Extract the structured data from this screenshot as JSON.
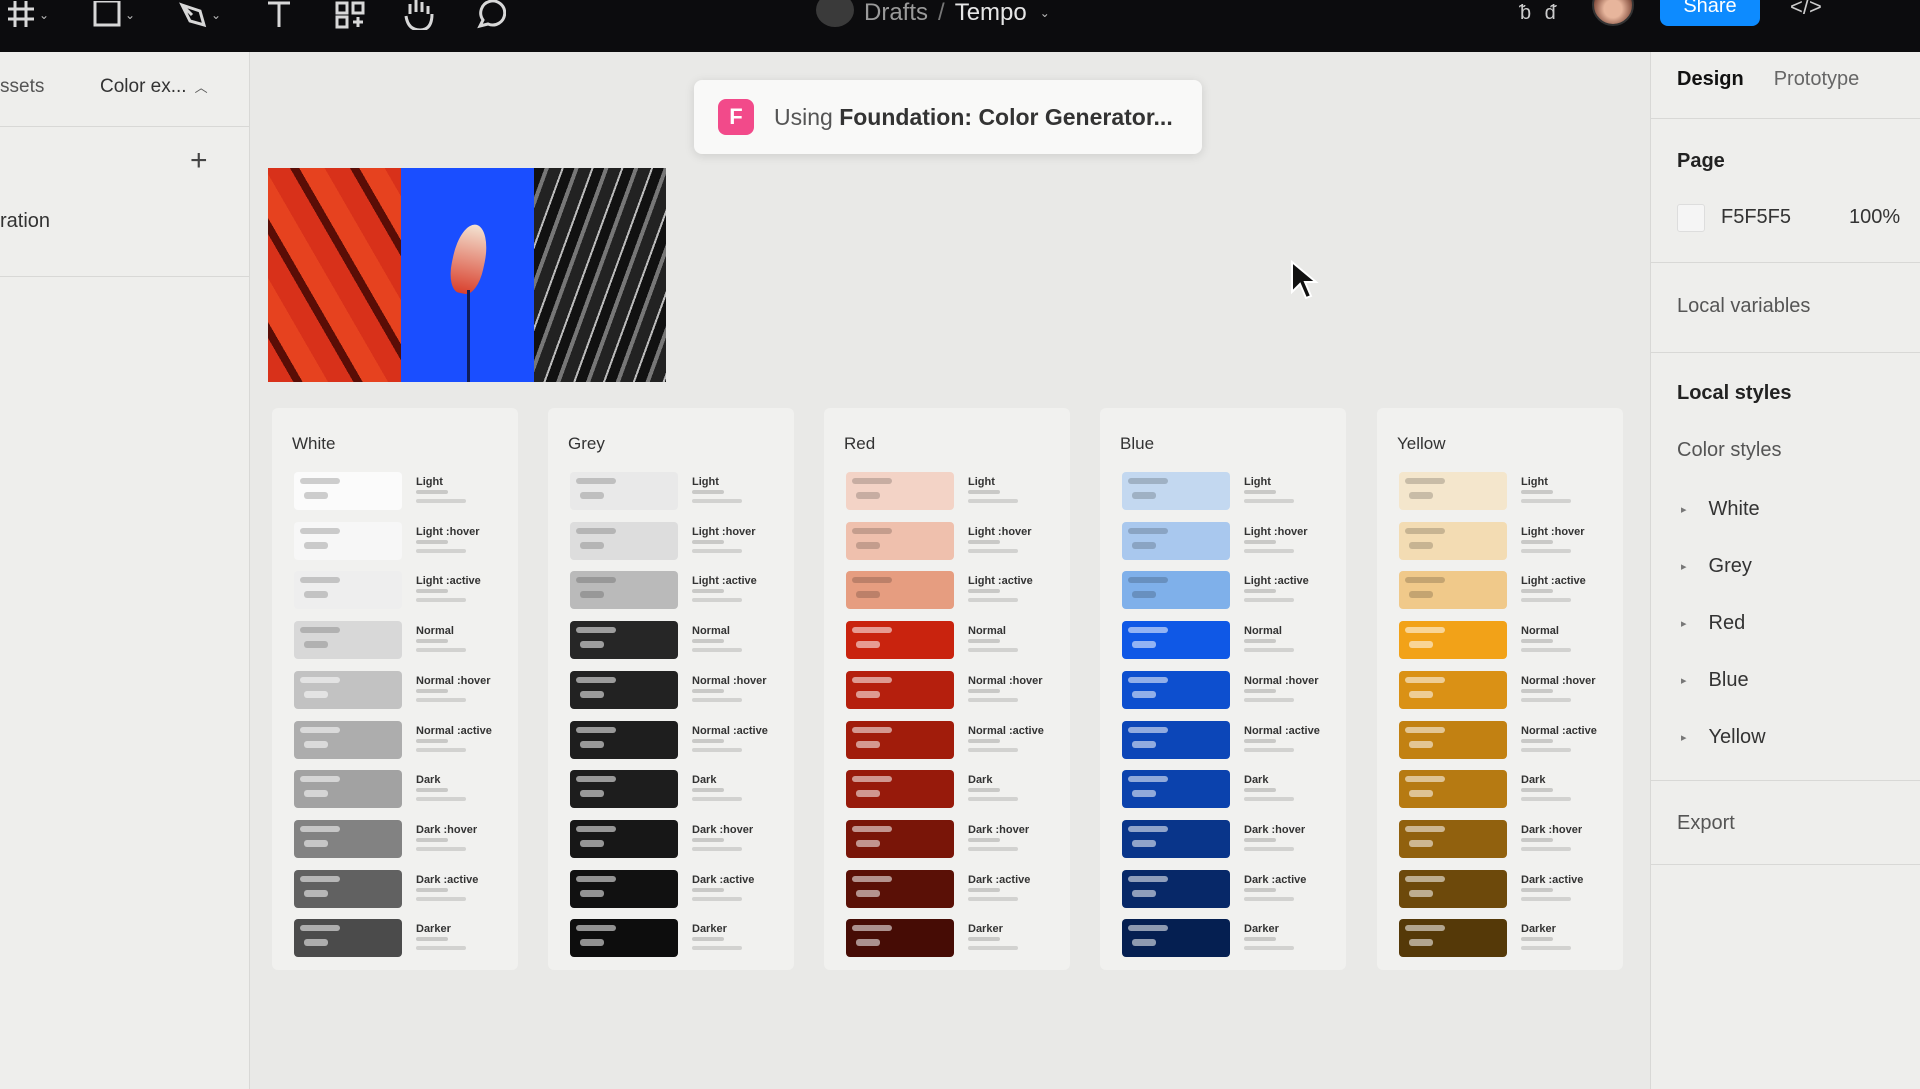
{
  "toolbar": {
    "file_project": "Drafts",
    "file_separator": "/",
    "file_name": "Tempo",
    "share_label": "Share",
    "multiplayer_glyph": "ᵬ ᵭ",
    "devmode_glyph": "</>",
    "icons": [
      "frame-icon",
      "shape-icon",
      "pen-icon",
      "text-icon",
      "component-icon",
      "hand-icon",
      "comment-icon"
    ]
  },
  "left_panel": {
    "assets_tab": "ssets",
    "page_tab": "Color ex...",
    "layer_item": "ration"
  },
  "toast": {
    "badge": "F",
    "prefix": "Using",
    "plugin": "Foundation: Color Generator..."
  },
  "palette_cards": [
    {
      "title": "White",
      "swatches": [
        {
          "name": "Light",
          "color": "#fbfbfb"
        },
        {
          "name": "Light :hover",
          "color": "#f7f7f7"
        },
        {
          "name": "Light :active",
          "color": "#eeeeee"
        },
        {
          "name": "Normal",
          "color": "#d8d8d8"
        },
        {
          "name": "Normal :hover",
          "color": "#c2c2c2"
        },
        {
          "name": "Normal :active",
          "color": "#adadad"
        },
        {
          "name": "Dark",
          "color": "#a2a2a2"
        },
        {
          "name": "Dark :hover",
          "color": "#828282"
        },
        {
          "name": "Dark :active",
          "color": "#616161"
        },
        {
          "name": "Darker",
          "color": "#4b4b4b"
        }
      ]
    },
    {
      "title": "Grey",
      "swatches": [
        {
          "name": "Light",
          "color": "#e9e9e9"
        },
        {
          "name": "Light :hover",
          "color": "#dddddd"
        },
        {
          "name": "Light :active",
          "color": "#bababa"
        },
        {
          "name": "Normal",
          "color": "#262626"
        },
        {
          "name": "Normal :hover",
          "color": "#222222"
        },
        {
          "name": "Normal :active",
          "color": "#1e1e1e"
        },
        {
          "name": "Dark",
          "color": "#1d1d1d"
        },
        {
          "name": "Dark :hover",
          "color": "#171717"
        },
        {
          "name": "Dark :active",
          "color": "#111111"
        },
        {
          "name": "Darker",
          "color": "#0d0d0d"
        }
      ]
    },
    {
      "title": "Red",
      "swatches": [
        {
          "name": "Light",
          "color": "#f3d3c6"
        },
        {
          "name": "Light :hover",
          "color": "#efc0ad"
        },
        {
          "name": "Light :active",
          "color": "#e69d80"
        },
        {
          "name": "Normal",
          "color": "#c9230e"
        },
        {
          "name": "Normal :hover",
          "color": "#b51f0d"
        },
        {
          "name": "Normal :active",
          "color": "#a11c0b"
        },
        {
          "name": "Dark",
          "color": "#971a0b"
        },
        {
          "name": "Dark :hover",
          "color": "#791508"
        },
        {
          "name": "Dark :active",
          "color": "#5a1006"
        },
        {
          "name": "Darker",
          "color": "#460c05"
        }
      ]
    },
    {
      "title": "Blue",
      "swatches": [
        {
          "name": "Light",
          "color": "#c3d8f0"
        },
        {
          "name": "Light :hover",
          "color": "#a9c8ee"
        },
        {
          "name": "Light :active",
          "color": "#7fb0ea"
        },
        {
          "name": "Normal",
          "color": "#0f58e6"
        },
        {
          "name": "Normal :hover",
          "color": "#0d4fcf"
        },
        {
          "name": "Normal :active",
          "color": "#0c46b8"
        },
        {
          "name": "Dark",
          "color": "#0b42ad"
        },
        {
          "name": "Dark :hover",
          "color": "#09358a"
        },
        {
          "name": "Dark :active",
          "color": "#072868"
        },
        {
          "name": "Darker",
          "color": "#051f51"
        }
      ]
    },
    {
      "title": "Yellow",
      "swatches": [
        {
          "name": "Light",
          "color": "#f4e6cc"
        },
        {
          "name": "Light :hover",
          "color": "#f3dcb3"
        },
        {
          "name": "Light :active",
          "color": "#f0c98a"
        },
        {
          "name": "Normal",
          "color": "#f2a218"
        },
        {
          "name": "Normal :hover",
          "color": "#da9115"
        },
        {
          "name": "Normal :active",
          "color": "#c28112"
        },
        {
          "name": "Dark",
          "color": "#b67a12"
        },
        {
          "name": "Dark :hover",
          "color": "#91610e"
        },
        {
          "name": "Dark :active",
          "color": "#6d490b"
        },
        {
          "name": "Darker",
          "color": "#553908"
        }
      ]
    }
  ],
  "right_panel": {
    "tab_design": "Design",
    "tab_prototype": "Prototype",
    "page_heading": "Page",
    "page_color_hex": "F5F5F5",
    "page_color_value": "#f5f5f5",
    "page_opacity": "100%",
    "local_variables": "Local variables",
    "local_styles": "Local styles",
    "color_styles": "Color styles",
    "style_groups": [
      "White",
      "Grey",
      "Red",
      "Blue",
      "Yellow"
    ],
    "export": "Export"
  }
}
